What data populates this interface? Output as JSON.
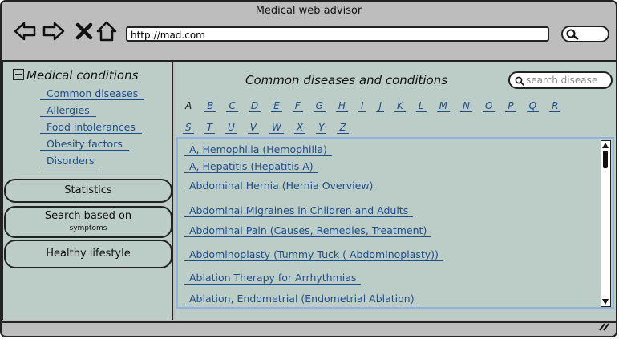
{
  "window": {
    "title": "Medical web advisor"
  },
  "toolbar": {
    "url": "http://mad.com",
    "icons": [
      "back-arrow-icon",
      "forward-arrow-icon",
      "close-icon",
      "home-icon",
      "search-icon"
    ]
  },
  "sidebar": {
    "heading": "Medical conditions",
    "links": [
      "Common diseases",
      "Allergies",
      "Food intolerances",
      "Obesity factors",
      "Disorders"
    ],
    "buttons": {
      "statistics": "Statistics",
      "search_line1": "Search based on",
      "search_line2": "symptoms",
      "healthy": "Healthy lifestyle"
    }
  },
  "main": {
    "title": "Common diseases and conditions",
    "search_placeholder": "search disease",
    "letters_row1": [
      "A",
      "B",
      "C",
      "D",
      "E",
      "F",
      "G",
      "H",
      "I",
      "J",
      "K",
      "L",
      "M",
      "N",
      "O",
      "P",
      "Q",
      "R"
    ],
    "letters_row2": [
      "S",
      "T",
      "U",
      "V",
      "W",
      "X",
      "Y",
      "Z"
    ],
    "active_letter": "A",
    "items": [
      "A, Hemophilia (Hemophilia)",
      "A, Hepatitis (Hepatitis A)",
      "Abdominal Hernia (Hernia Overview)",
      "Abdominal Migraines in Children and Adults",
      "Abdominal Pain (Causes, Remedies, Treatment)",
      "Abdominoplasty (Tummy Tuck ( Abdominoplasty))",
      "Ablation Therapy for Arrhythmias",
      "Ablation, Endometrial (Endometrial Ablation)"
    ]
  }
}
